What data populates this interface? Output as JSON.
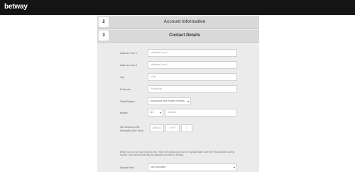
{
  "header": {
    "logo_text": "betway",
    "background": "#141414"
  },
  "steps": [
    {
      "number": "2",
      "title": "Account Information"
    },
    {
      "number": "3",
      "title": "Contact Details"
    }
  ],
  "form": {
    "address1": {
      "label": "Address Line 1",
      "placeholder": "Address Line 1"
    },
    "address2": {
      "label": "Address Line 2",
      "placeholder": "Address Line 2"
    },
    "city": {
      "label": "City",
      "placeholder": "City"
    },
    "postcode": {
      "label": "Postcode",
      "placeholder": "Postcode"
    },
    "state": {
      "label": "State/Region",
      "value": "Antarctica and Robbie Islands"
    },
    "mobile": {
      "label": "Mobile",
      "code": "61",
      "placeholder": "Mobile"
    },
    "deposit_limit": {
      "label": "Net Deposit Limit Estimated (Per Year)",
      "day_placeholder": "MM/DD",
      "month_placeholder": "YYYY",
      "year_placeholder": "1"
    },
    "notice": "Before you can set your deposit limit. These are optional and can be changed later under the Responsible Gaming section. Your deposit limit may be adjusted at a later by Betway.",
    "deposit_period": {
      "label": "Deposit limit",
      "value": "Not Specified"
    }
  }
}
